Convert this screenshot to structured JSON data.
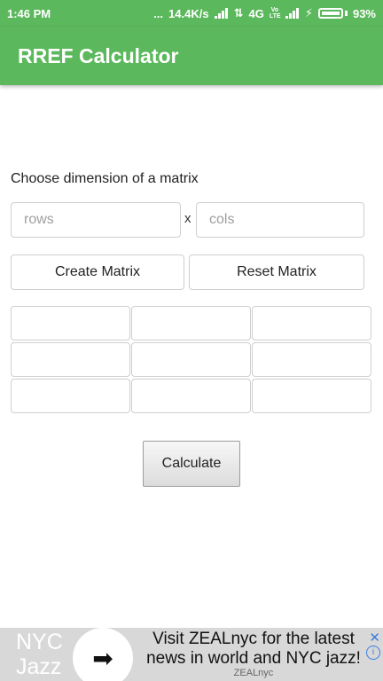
{
  "status_bar": {
    "time": "1:46 PM",
    "dots": "...",
    "speed": "14.4K/s",
    "network": "4G",
    "volte": "Vo LTE",
    "battery_percent": "93%",
    "battery_level": 0.93
  },
  "app_bar": {
    "title": "RREF Calculator"
  },
  "form": {
    "prompt": "Choose dimension of a matrix",
    "rows_placeholder": "rows",
    "times_symbol": "x",
    "cols_placeholder": "cols",
    "create_label": "Create Matrix",
    "reset_label": "Reset Matrix",
    "matrix_rows": 3,
    "matrix_cols": 3,
    "calculate_label": "Calculate"
  },
  "ad": {
    "logo_line1": "NYC",
    "logo_line2": "Jazz",
    "arrow_icon": "arrow-right-icon",
    "text": "Visit ZEALnyc for the latest news in world and NYC jazz!",
    "brand": "ZEALnyc",
    "close_symbol": "✕",
    "info_symbol": "i",
    "accent": "#3b7de0"
  },
  "colors": {
    "primary": "#5cb85c",
    "background": "#ffffff",
    "border": "#cfcfcf"
  }
}
